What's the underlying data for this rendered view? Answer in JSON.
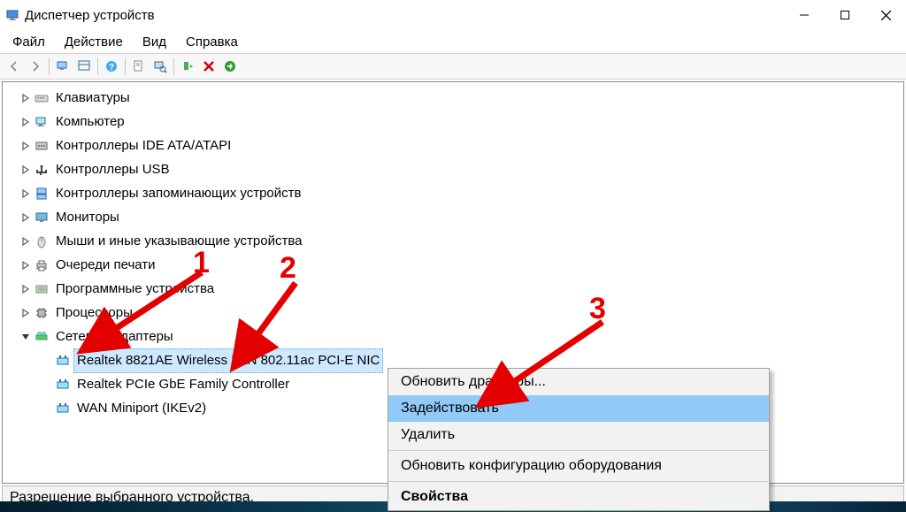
{
  "window": {
    "title": "Диспетчер устройств"
  },
  "menu": {
    "file": "Файл",
    "action": "Действие",
    "view": "Вид",
    "help": "Справка"
  },
  "tree": {
    "items": [
      {
        "label": "Клавиатуры",
        "icon": "keyboard",
        "expand": "collapsed"
      },
      {
        "label": "Компьютер",
        "icon": "computer",
        "expand": "collapsed"
      },
      {
        "label": "Контроллеры IDE ATA/ATAPI",
        "icon": "ide",
        "expand": "collapsed"
      },
      {
        "label": "Контроллеры USB",
        "icon": "usb",
        "expand": "collapsed"
      },
      {
        "label": "Контроллеры запоминающих устройств",
        "icon": "storage",
        "expand": "collapsed"
      },
      {
        "label": "Мониторы",
        "icon": "monitor",
        "expand": "collapsed"
      },
      {
        "label": "Мыши и иные указывающие устройства",
        "icon": "mouse",
        "expand": "collapsed"
      },
      {
        "label": "Очереди печати",
        "icon": "printer",
        "expand": "collapsed"
      },
      {
        "label": "Программные устройства",
        "icon": "software",
        "expand": "collapsed"
      },
      {
        "label": "Процессоры",
        "icon": "cpu",
        "expand": "collapsed"
      },
      {
        "label": "Сетевые адаптеры",
        "icon": "network",
        "expand": "expanded"
      }
    ],
    "network_children": [
      {
        "label": "Realtek 8821AE Wireless LAN 802.11ac PCI-E NIC",
        "selected": true
      },
      {
        "label": "Realtek PCIe GbE Family Controller",
        "selected": false
      },
      {
        "label": "WAN Miniport (IKEv2)",
        "selected": false
      }
    ]
  },
  "context_menu": {
    "update_drivers": "Обновить драйверы...",
    "enable": "Задействовать",
    "delete": "Удалить",
    "scan_hw": "Обновить конфигурацию оборудования",
    "properties": "Свойства"
  },
  "status": {
    "text": "Разрешение выбранного устройства."
  },
  "annotations": {
    "one": "1",
    "two": "2",
    "three": "3"
  }
}
